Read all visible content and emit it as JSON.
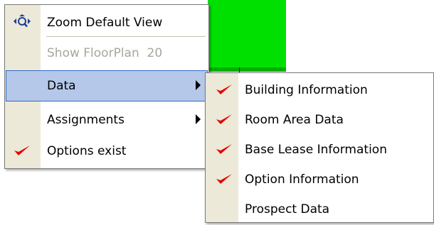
{
  "main_menu": {
    "items": [
      {
        "label": "Zoom Default View",
        "icon": "zoom-icon",
        "enabled": true
      },
      {
        "label": "Show FloorPlan  20",
        "enabled": false
      },
      {
        "label": "Data",
        "has_submenu": true,
        "highlighted": true
      },
      {
        "label": "Assignments",
        "has_submenu": true
      },
      {
        "label": "Options exist",
        "icon": "checkmark-icon",
        "checked": true
      }
    ]
  },
  "submenu": {
    "items": [
      {
        "label": "Building Information",
        "checked": true
      },
      {
        "label": "Room Area Data",
        "checked": true
      },
      {
        "label": "Base Lease Information",
        "checked": true
      },
      {
        "label": "Option Information",
        "checked": true
      },
      {
        "label": "Prospect Data",
        "checked": false
      }
    ]
  },
  "colors": {
    "highlight_bg": "#b5c8e9",
    "highlight_border": "#3169c6",
    "gutter": "#ece9d8",
    "check": "#e60000",
    "background_green": "#00e000"
  }
}
